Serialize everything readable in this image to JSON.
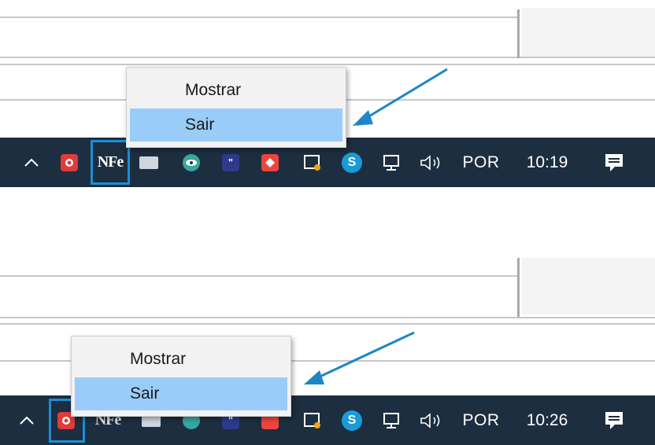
{
  "screenshots": [
    {
      "menu": {
        "items": [
          {
            "label": "Mostrar"
          },
          {
            "label": "Sair"
          }
        ],
        "selected_item": "Sair"
      },
      "tray": {
        "language": "POR",
        "clock": "10:19",
        "highlighted_icon": "nfe-icon",
        "nfe_label": "NFe"
      }
    },
    {
      "menu": {
        "items": [
          {
            "label": "Mostrar"
          },
          {
            "label": "Sair"
          }
        ],
        "selected_item": "Sair"
      },
      "tray": {
        "language": "POR",
        "clock": "10:26",
        "highlighted_icon": "red-gear-app-icon",
        "nfe_label": "NFe"
      }
    }
  ],
  "colors": {
    "taskbar": "#1c2e3f",
    "menu_selected": "#99ccf9",
    "highlight": "#1d8ed6",
    "arrow": "#1e86c6"
  }
}
